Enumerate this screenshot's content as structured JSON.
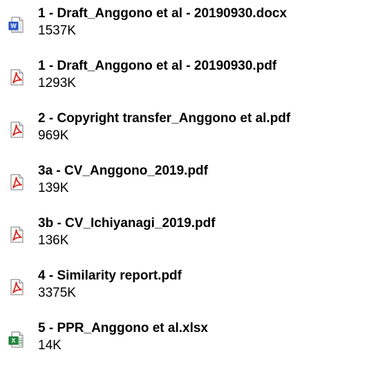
{
  "attachments": [
    {
      "name": "1 - Draft_Anggono et al - 20190930.docx",
      "size": "1537K",
      "type": "word"
    },
    {
      "name": "1 - Draft_Anggono et al - 20190930.pdf",
      "size": "1293K",
      "type": "pdf"
    },
    {
      "name": "2 - Copyright transfer_Anggono et al.pdf",
      "size": "969K",
      "type": "pdf"
    },
    {
      "name": "3a - CV_Anggono_2019.pdf",
      "size": "139K",
      "type": "pdf"
    },
    {
      "name": "3b - CV_Ichiyanagi_2019.pdf",
      "size": "136K",
      "type": "pdf"
    },
    {
      "name": "4 - Similarity report.pdf",
      "size": "3375K",
      "type": "pdf"
    },
    {
      "name": "5 - PPR_Anggono et al.xlsx",
      "size": "14K",
      "type": "excel"
    }
  ],
  "icons": {
    "word": "word-document-icon",
    "pdf": "pdf-document-icon",
    "excel": "excel-spreadsheet-icon"
  },
  "colors": {
    "pdf_red": "#d8261c",
    "word_blue": "#2a5bd7",
    "excel_green": "#1f8a3c",
    "text": "#000000"
  }
}
